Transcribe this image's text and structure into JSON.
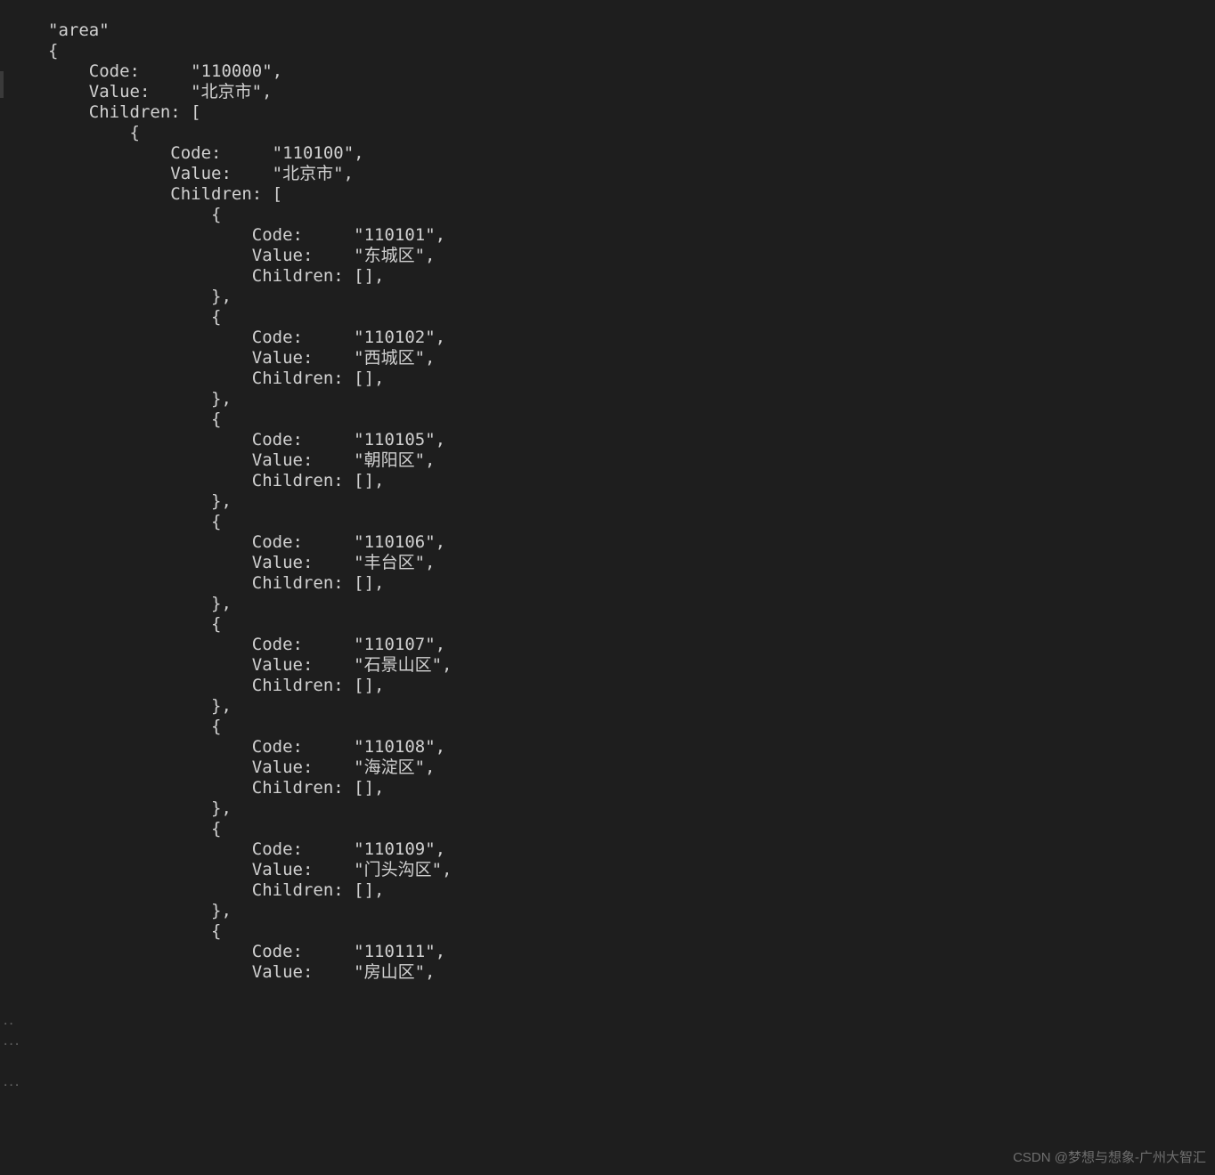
{
  "code": {
    "header": "\"area\"",
    "root_open": "{",
    "root_code_key": "    Code:     ",
    "root_code_val": "\"110000\",",
    "root_value_key": "    Value:    ",
    "root_value_val": "\"北京市\",",
    "root_children": "    Children: [",
    "lvl2_open": "        {",
    "lvl2_code_key": "            Code:     ",
    "lvl2_code_val": "\"110100\",",
    "lvl2_value_key": "            Value:    ",
    "lvl2_value_val": "\"北京市\",",
    "lvl2_children": "            Children: [",
    "item_open": "                {",
    "item_close": "                },",
    "item_code_key": "                    Code:     ",
    "item_value_key": "                    Value:    ",
    "item_children": "                    Children: [],",
    "districts": [
      {
        "code": "\"110101\",",
        "value": "\"东城区\","
      },
      {
        "code": "\"110102\",",
        "value": "\"西城区\","
      },
      {
        "code": "\"110105\",",
        "value": "\"朝阳区\","
      },
      {
        "code": "\"110106\",",
        "value": "\"丰台区\","
      },
      {
        "code": "\"110107\",",
        "value": "\"石景山区\","
      },
      {
        "code": "\"110108\",",
        "value": "\"海淀区\","
      },
      {
        "code": "\"110109\",",
        "value": "\"门头沟区\","
      },
      {
        "code": "\"110111\",",
        "value": "\"房山区\","
      }
    ]
  },
  "gutter": {
    "mark1": "..",
    "mark2": "...",
    "mark3": "..."
  },
  "watermark": "CSDN @梦想与想象-广州大智汇"
}
